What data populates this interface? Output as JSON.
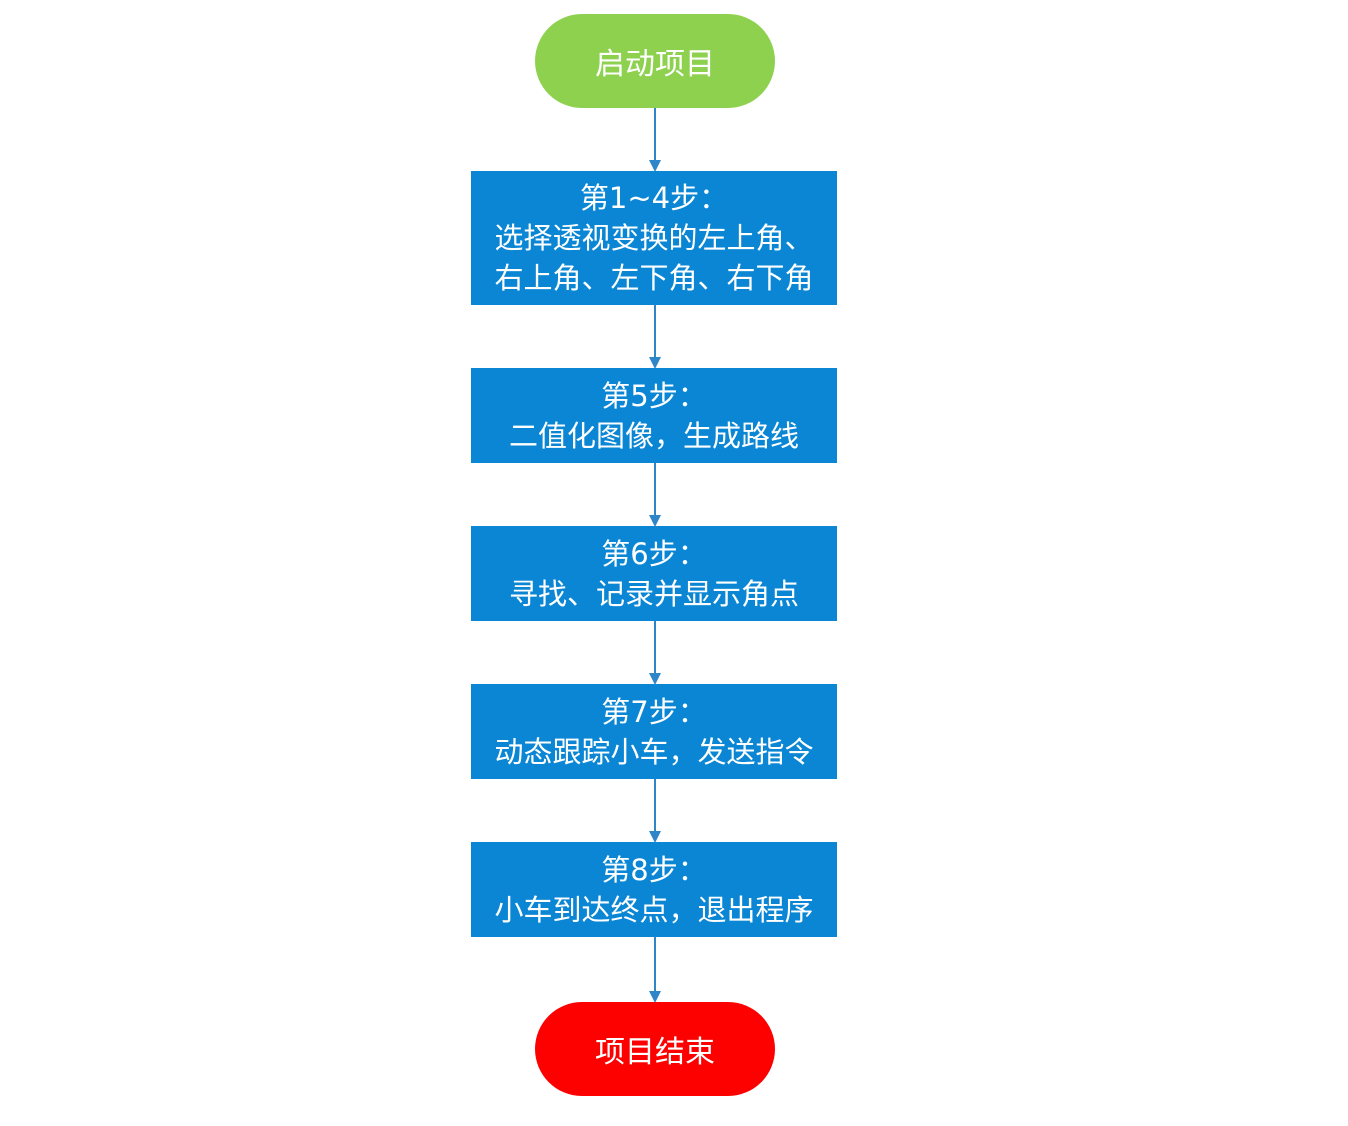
{
  "colors": {
    "start_fill": "#8ed14f",
    "end_fill": "#fd0000",
    "process_fill": "#0a86d4",
    "connector": "#2e86c8"
  },
  "start": {
    "label": "启动项目"
  },
  "steps": [
    {
      "lines": [
        "第1~4步：",
        "选择透视变换的左上角、",
        "右上角、左下角、右下角"
      ]
    },
    {
      "lines": [
        "第5步：",
        "二值化图像，生成路线"
      ]
    },
    {
      "lines": [
        "第6步：",
        "寻找、记录并显示角点"
      ]
    },
    {
      "lines": [
        "第7步：",
        "动态跟踪小车，发送指令"
      ]
    },
    {
      "lines": [
        "第8步：",
        "小车到达终点，退出程序"
      ]
    }
  ],
  "end": {
    "label": "项目结束"
  }
}
